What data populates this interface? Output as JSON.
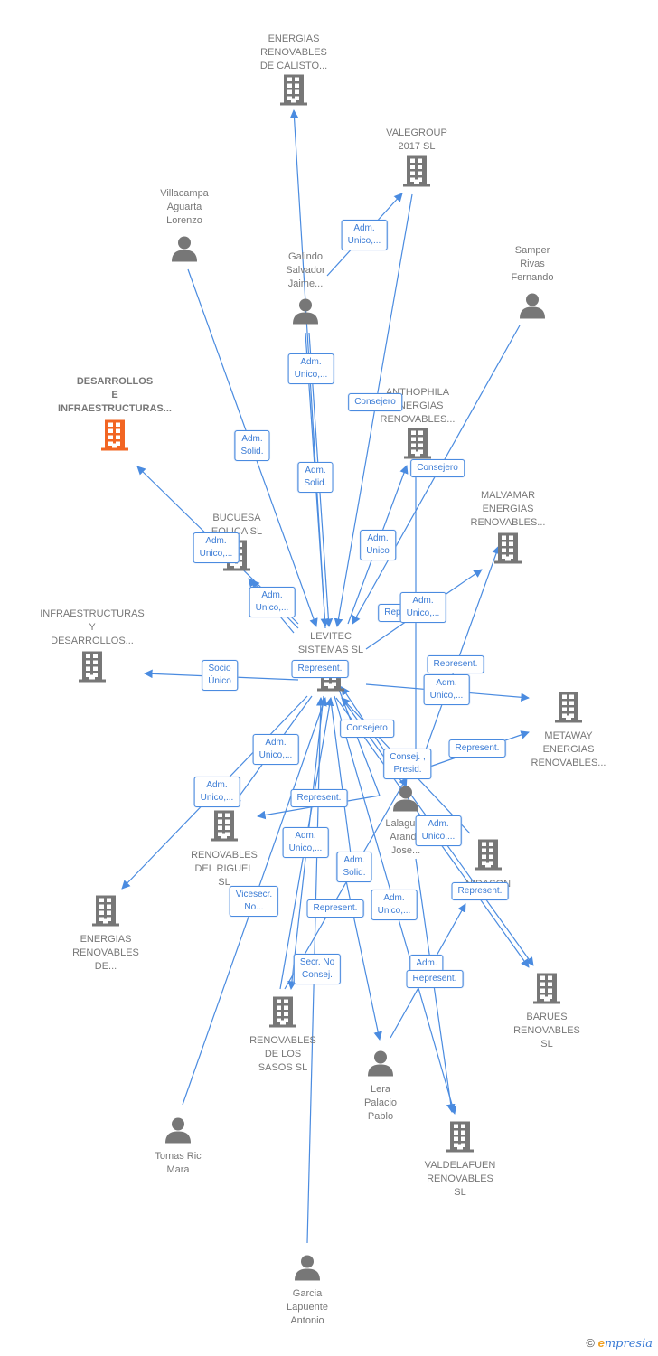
{
  "colors": {
    "edge": "#4a8be0",
    "node_icon": "#777777",
    "highlight_icon": "#f26522",
    "label_text": "#777777"
  },
  "nodes": [
    {
      "id": "calisto",
      "type": "building",
      "lines": [
        "ENERGIAS",
        "RENOVABLES",
        "DE CALISTO..."
      ]
    },
    {
      "id": "valegroup",
      "type": "building",
      "lines": [
        "VALEGROUP",
        "2017  SL"
      ]
    },
    {
      "id": "villacampa",
      "type": "person",
      "lines": [
        "Villacampa",
        "Aguarta",
        "Lorenzo"
      ]
    },
    {
      "id": "galindo",
      "type": "person",
      "lines": [
        "Galindo",
        "Salvador",
        "Jaime..."
      ]
    },
    {
      "id": "samper",
      "type": "person",
      "lines": [
        "Samper",
        "Rivas",
        "Fernando"
      ]
    },
    {
      "id": "desarrollos",
      "type": "building",
      "highlight": true,
      "lines": [
        "DESARROLLOS",
        "E",
        "INFRAESTRUCTURAS..."
      ]
    },
    {
      "id": "anthophila",
      "type": "building",
      "lines": [
        "ANTHOPHILA",
        "ENERGIAS",
        "RENOVABLES..."
      ]
    },
    {
      "id": "bucuesa",
      "type": "building",
      "lines": [
        "BUCUESA",
        "EOLICA  SL"
      ]
    },
    {
      "id": "malvamar",
      "type": "building",
      "lines": [
        "MALVAMAR",
        "ENERGIAS",
        "RENOVABLES..."
      ]
    },
    {
      "id": "infraestructuras",
      "type": "building",
      "lines": [
        "INFRAESTRUCTURAS",
        "Y",
        "DESARROLLOS..."
      ]
    },
    {
      "id": "levitec",
      "type": "building",
      "lines": [
        "LEVITEC",
        "SISTEMAS  SL"
      ]
    },
    {
      "id": "metaway",
      "type": "building",
      "lines": [
        "METAWAY",
        "ENERGIAS",
        "RENOVABLES..."
      ]
    },
    {
      "id": "lalaguna",
      "type": "person",
      "lines": [
        "Lalaguna",
        "Aranda",
        "Jose..."
      ]
    },
    {
      "id": "riguel",
      "type": "building",
      "lines": [
        "RENOVABLES",
        "DEL RIGUEL",
        "SL"
      ]
    },
    {
      "id": "nidason",
      "type": "building",
      "lines": [
        "NIDASON"
      ]
    },
    {
      "id": "energiasde",
      "type": "building",
      "lines": [
        "ENERGIAS",
        "RENOVABLES",
        "DE..."
      ]
    },
    {
      "id": "barues",
      "type": "building",
      "lines": [
        "BARUES",
        "RENOVABLES",
        "SL"
      ]
    },
    {
      "id": "sasos",
      "type": "building",
      "lines": [
        "RENOVABLES",
        "DE LOS",
        "SASOS  SL"
      ]
    },
    {
      "id": "lera",
      "type": "person",
      "lines": [
        "Lera",
        "Palacio",
        "Pablo"
      ]
    },
    {
      "id": "tomas",
      "type": "person",
      "lines": [
        "Tomas Ric",
        "Mara"
      ]
    },
    {
      "id": "valdelafuen",
      "type": "building",
      "lines": [
        "VALDELAFUEN",
        "RENOVABLES",
        "SL"
      ]
    },
    {
      "id": "garcia",
      "type": "person",
      "lines": [
        "Garcia",
        "Lapuente",
        "Antonio"
      ]
    }
  ],
  "edge_labels": [
    [
      "Adm.",
      "Unico,..."
    ],
    [
      "Adm.",
      "Solid."
    ],
    [
      "Adm.",
      "Unico,..."
    ],
    [
      "Adm.",
      "Solid."
    ],
    [
      "Consejero"
    ],
    [
      "Consejero"
    ],
    [
      "Adm.",
      "Unico"
    ],
    [
      "Adm.",
      "Unico,..."
    ],
    [
      "Adm.",
      "Unico,..."
    ],
    [
      "Repr..."
    ],
    [
      "Adm.",
      "Unico,..."
    ],
    [
      "Socio",
      "Único"
    ],
    [
      "Represent."
    ],
    [
      "Represent."
    ],
    [
      "Adm.",
      "Unico,..."
    ],
    [
      "Consejero"
    ],
    [
      "Consej. ,",
      "Presid."
    ],
    [
      "Represent."
    ],
    [
      "Adm.",
      "Unico,..."
    ],
    [
      "Adm.",
      "Unico,..."
    ],
    [
      "Represent."
    ],
    [
      "Adm.",
      "Unico,..."
    ],
    [
      "Adm.",
      "Solid."
    ],
    [
      "Vicesecr.",
      "No..."
    ],
    [
      "Represent."
    ],
    [
      "Adm.",
      "Unico,..."
    ],
    [
      "Secr.  No",
      "Consej."
    ],
    [
      "Adm.",
      "Unico,..."
    ],
    [
      "Represent."
    ],
    [
      "Adm."
    ],
    [
      "Represent."
    ]
  ],
  "logo": {
    "copyright": "©",
    "brand_initial": "e",
    "brand_rest": "mpresia"
  }
}
